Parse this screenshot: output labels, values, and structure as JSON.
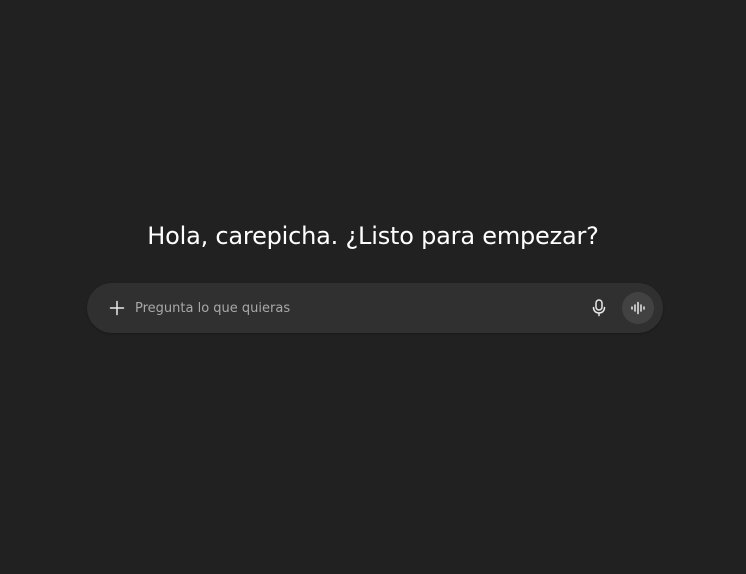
{
  "greeting": "Hola, carepicha. ¿Listo para empezar?",
  "composer": {
    "placeholder": "Pregunta lo que quieras",
    "value": ""
  },
  "icons": {
    "attach": "plus-icon",
    "dictate": "microphone-icon",
    "voice": "voice-waveform-icon"
  },
  "colors": {
    "background": "#212121",
    "composer_background": "#303030",
    "voice_button_background": "#424242",
    "text": "#ffffff",
    "placeholder": "#a8a8a8"
  }
}
